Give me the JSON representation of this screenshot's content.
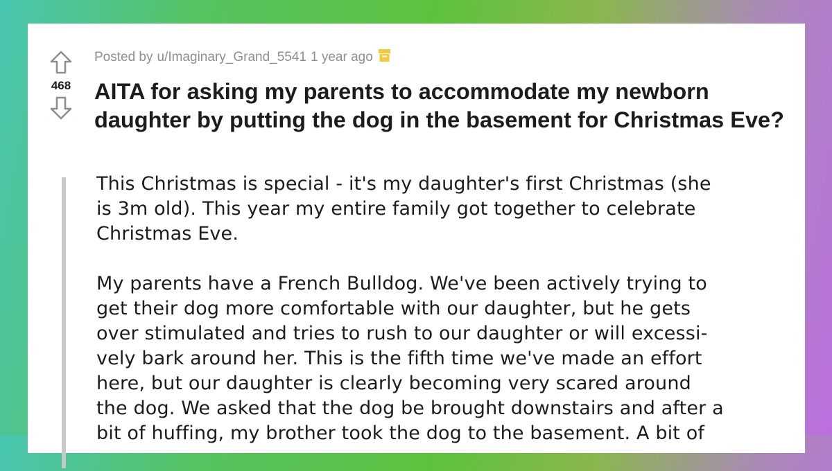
{
  "post": {
    "posted_by_prefix": "Posted by",
    "author": "u/Imaginary_Grand_5541",
    "age": "1 year ago",
    "vote_count": "468",
    "title_lines": [
      "AITA for asking my parents to accommodate my newborn",
      "daughter by putting the dog in the basement for Christmas Eve?"
    ],
    "body": [
      [
        "This Christmas is special - it's my daughter's first Christmas (she",
        "is 3m old). This year my entire family got together to celebrate",
        "Christmas Eve."
      ],
      [
        "My parents have a French Bulldog. We've been actively trying to",
        "get their dog more comfortable with our daughter, but he gets",
        "over stimulated and tries to rush to our daughter or will excessi-",
        "vely bark around her. This is the fifth time we've made an effort",
        "here, but our daughter is clearly becoming very scared around",
        "the dog. We asked that the dog be brought downstairs and after a",
        "bit of huffing, my brother took the dog to the basement. A bit of"
      ]
    ]
  },
  "icons": {
    "upvote": "arrow-up-outline-icon",
    "downvote": "arrow-down-outline-icon",
    "award": "award-badge-icon"
  },
  "colors": {
    "background_gradient": [
      "#49c6b2",
      "#5cc23e",
      "#bb6fdf"
    ],
    "card": "#ffffff",
    "meta_text": "#8b8f93",
    "title_text": "#1c1c1c",
    "quote_bar": "#c8c8c8",
    "award": "#f0c93c"
  }
}
